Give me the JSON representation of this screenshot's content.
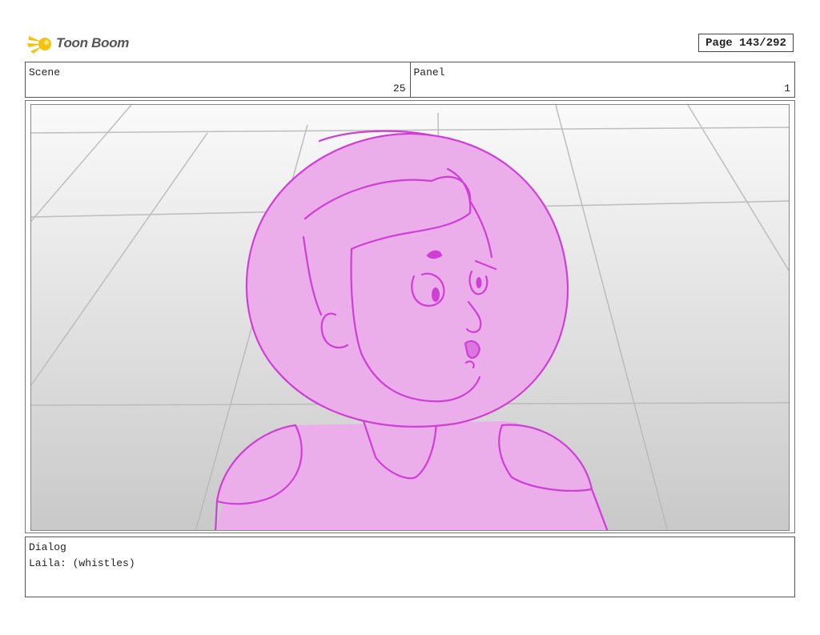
{
  "header": {
    "logo_text": "Toon Boom",
    "page_label": "Page 143/292"
  },
  "fields": {
    "scene_label": "Scene",
    "scene_value": "25",
    "panel_label": "Panel",
    "panel_value": "1"
  },
  "panel": {
    "image": "storyboard-sketch-character-in-helmet",
    "sketch_color": "#cf3fd6",
    "fill_color": "#ebaeea"
  },
  "dialog": {
    "label": "Dialog",
    "text": "Laila: (whistles)"
  }
}
